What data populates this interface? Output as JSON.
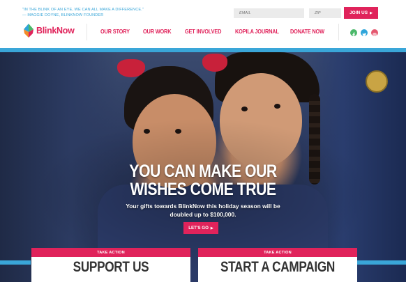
{
  "header": {
    "quote": "\"In the blink of an eye, we can all make a difference.\"",
    "quote_author": "— Maggie Doyne, BlinkNow Founder",
    "email_placeholder": "EMAIL",
    "zip_placeholder": "ZIP",
    "join_label": "JOIN US",
    "logo_text": "BlinkNow"
  },
  "nav": {
    "items": [
      {
        "label": "OUR STORY"
      },
      {
        "label": "OUR WORK"
      },
      {
        "label": "GET INVOLVED"
      },
      {
        "label": "KOPILA JOURNAL"
      },
      {
        "label": "DONATE NOW"
      }
    ]
  },
  "social": {
    "facebook_color": "#4bb86a",
    "twitter_color": "#2fa5da",
    "instagram_color": "#e5576f"
  },
  "hero": {
    "headline_line1": "YOU CAN MAKE OUR",
    "headline_line2": "WISHES COME TRUE",
    "subtext": "Your gifts towards BlinkNow this holiday season will be doubled up to $100,000.",
    "cta_label": "LET'S GO"
  },
  "cards": [
    {
      "tag": "TAKE ACTION",
      "title": "SUPPORT US"
    },
    {
      "tag": "TAKE ACTION",
      "title": "START A CAMPAIGN"
    }
  ],
  "colors": {
    "accent": "#e0235b",
    "blue": "#3aa6d8"
  }
}
